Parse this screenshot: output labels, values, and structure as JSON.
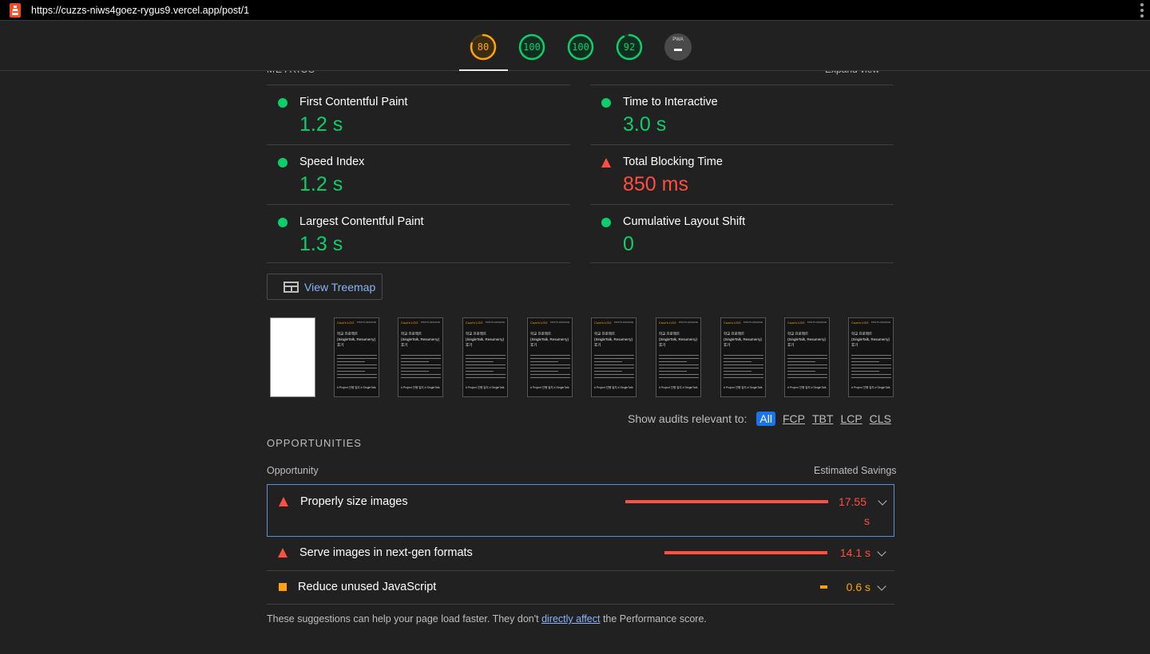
{
  "browser": {
    "url": "https://cuzzs-niws4goez-rygus9.vercel.app/post/1"
  },
  "gauges": [
    {
      "label": "80",
      "score": 0.8,
      "color": "#ffa400"
    },
    {
      "label": "100",
      "score": 1.0,
      "color": "#0cce6b"
    },
    {
      "label": "100",
      "score": 1.0,
      "color": "#0cce6b"
    },
    {
      "label": "92",
      "score": 0.92,
      "color": "#0cce6b"
    },
    {
      "label": "PWA",
      "type": "pwa"
    }
  ],
  "metrics": {
    "heading": "METRICS",
    "expand_label": "Expand view",
    "items": [
      {
        "title": "First Contentful Paint",
        "value": "1.2 s",
        "status": "pass"
      },
      {
        "title": "Time to Interactive",
        "value": "3.0 s",
        "status": "pass"
      },
      {
        "title": "Speed Index",
        "value": "1.2 s",
        "status": "pass"
      },
      {
        "title": "Total Blocking Time",
        "value": "850 ms",
        "status": "fail"
      },
      {
        "title": "Largest Contentful Paint",
        "value": "1.3 s",
        "status": "pass"
      },
      {
        "title": "Cumulative Layout Shift",
        "value": "0",
        "status": "pass"
      }
    ]
  },
  "treemap": {
    "label": "View Treemap"
  },
  "filmstrip": {
    "frame_logo": "Cuzz's LOG",
    "frame_nav": "POSTS ARCHIVE",
    "frame_title": "학교 프로젝트 (SingleTalk, Resumerry) 후기",
    "frame_footer": "# Project 진행 일지 # SingleTalk"
  },
  "filter": {
    "label": "Show audits relevant to:",
    "chips": [
      "All",
      "FCP",
      "TBT",
      "LCP",
      "CLS"
    ],
    "active": "All"
  },
  "opportunities": {
    "heading": "OPPORTUNITIES",
    "col_left": "Opportunity",
    "col_right": "Estimated Savings",
    "items": [
      {
        "title": "Properly size images",
        "saving": "17.55",
        "saving_unit": "s",
        "status": "fail",
        "savings_seconds": 17.55
      },
      {
        "title": "Serve images in next-gen formats",
        "saving": "14.1 s",
        "status": "fail",
        "savings_seconds": 14.1
      },
      {
        "title": "Reduce unused JavaScript",
        "saving": "0.6 s",
        "status": "average",
        "savings_seconds": 0.6
      }
    ]
  },
  "footer": {
    "before": "These suggestions can help your page load faster. They don't ",
    "link": "directly affect",
    "after": " the Performance score."
  }
}
